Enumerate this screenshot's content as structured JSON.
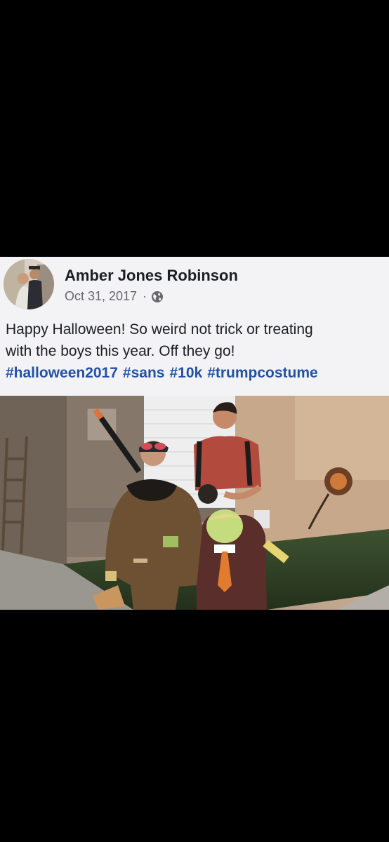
{
  "post": {
    "author": "Amber Jones Robinson",
    "date": "Oct 31, 2017",
    "separator": "·",
    "privacy_icon": "globe-icon",
    "text_line_1": "Happy Halloween! So weird not trick or treating",
    "text_line_2": "with the boys this year. Off they go!",
    "hashtags": [
      "#halloween2017",
      "#sans",
      "#10k",
      "#trumpcostume"
    ]
  },
  "colors": {
    "hashtag": "#2051a8",
    "author": "#1c1e21",
    "meta": "#65676b",
    "post_bg": "#f3f3f5",
    "screen_bg": "#000000"
  }
}
